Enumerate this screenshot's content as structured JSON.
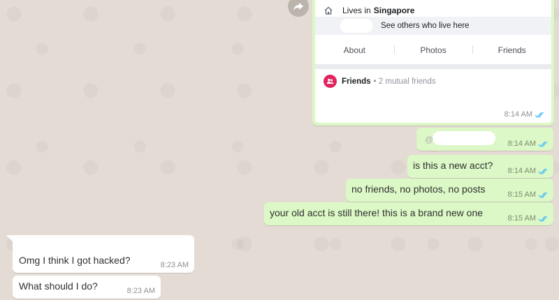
{
  "colors": {
    "outgoing_bubble": "#dcf8c6",
    "incoming_bubble": "#ffffff",
    "read_ticks": "#4fc3f7",
    "friends_icon": "#e0245e"
  },
  "icons": {
    "forward": "forward-arrow-icon",
    "home": "home-icon",
    "friends": "friends-icon",
    "ticks": "double-check-icon"
  },
  "shared_card": {
    "lives_prefix": "Lives in",
    "lives_place": "Singapore",
    "see_others": "See others who live here",
    "tabs": [
      "About",
      "Photos",
      "Friends"
    ],
    "friends_label": "Friends",
    "mutual_friends": "• 2 mutual friends",
    "time": "8:14 AM"
  },
  "outgoing": [
    {
      "text": "@",
      "time": "8:14 AM"
    },
    {
      "text": "is this a new acct?",
      "time": "8:14 AM"
    },
    {
      "text": "no friends, no photos, no posts",
      "time": "8:15 AM"
    },
    {
      "text": "your old acct is still there! this is a brand new one",
      "time": "8:15 AM"
    }
  ],
  "incoming": [
    {
      "text": "Omg I think I got hacked?",
      "time": "8:23 AM"
    },
    {
      "text": "What should I do?",
      "time": "8:23 AM"
    }
  ]
}
